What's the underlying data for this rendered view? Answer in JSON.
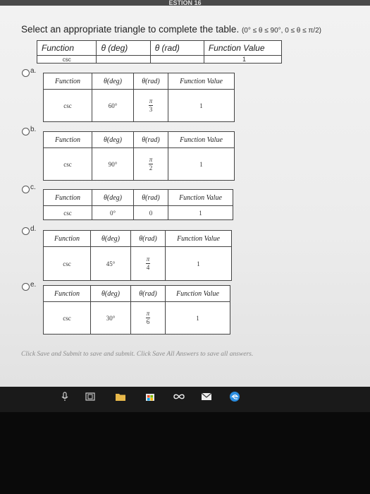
{
  "header": {
    "title": "ESTION 16"
  },
  "question": {
    "text": "Select an appropriate triangle to complete the table.",
    "range": "(0° ≤ θ ≤ 90°, 0 ≤ θ ≤ π/2)"
  },
  "main_table": {
    "headers": [
      "Function",
      "θ (deg)",
      "θ (rad)",
      "Function Value"
    ],
    "row": {
      "function": "csc",
      "deg": "",
      "rad": "",
      "value": "1"
    }
  },
  "options": [
    {
      "letter": "a.",
      "headers": [
        "Function",
        "θ(deg)",
        "θ(rad)",
        "Function Value"
      ],
      "function": "csc",
      "deg": "60°",
      "rad_num": "π",
      "rad_den": "3",
      "rad_text": "",
      "value": "1"
    },
    {
      "letter": "b.",
      "headers": [
        "Function",
        "θ(deg)",
        "θ(rad)",
        "Function Value"
      ],
      "function": "csc",
      "deg": "90°",
      "rad_num": "π",
      "rad_den": "2",
      "rad_text": "",
      "value": "1"
    },
    {
      "letter": "c.",
      "headers": [
        "Function",
        "θ(deg)",
        "θ(rad)",
        "Function Value"
      ],
      "function": "csc",
      "deg": "0°",
      "rad_num": "",
      "rad_den": "",
      "rad_text": "0",
      "value": "1"
    },
    {
      "letter": "d.",
      "headers": [
        "Function",
        "θ(deg)",
        "θ(rad)",
        "Function Value"
      ],
      "function": "csc",
      "deg": "45°",
      "rad_num": "π",
      "rad_den": "4",
      "rad_text": "",
      "value": "1"
    },
    {
      "letter": "e.",
      "headers": [
        "Function",
        "θ(deg)",
        "θ(rad)",
        "Function Value"
      ],
      "function": "csc",
      "deg": "30°",
      "rad_num": "π",
      "rad_den": "6",
      "rad_text": "",
      "value": "1"
    }
  ],
  "footer": {
    "note": "Click Save and Submit to save and submit. Click Save All Answers to save all answers."
  },
  "taskbar": {
    "icons": [
      "microphone-icon",
      "task-view-icon",
      "file-explorer-icon",
      "store-icon",
      "infinity-app-icon",
      "mail-icon",
      "edge-icon"
    ]
  }
}
